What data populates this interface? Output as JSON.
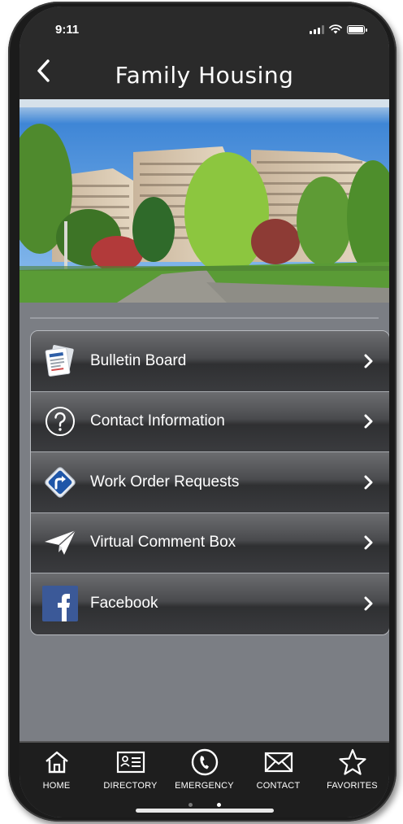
{
  "status_bar": {
    "time": "9:11"
  },
  "nav": {
    "title": "Family Housing",
    "back_icon": "chevron-left-icon"
  },
  "menu": {
    "items": [
      {
        "label": "Bulletin Board",
        "icon": "bulletin-board-icon"
      },
      {
        "label": "Contact Information",
        "icon": "question-circle-icon"
      },
      {
        "label": "Work Order Requests",
        "icon": "directions-sign-icon"
      },
      {
        "label": "Virtual Comment Box",
        "icon": "paper-plane-icon"
      },
      {
        "label": "Facebook",
        "icon": "facebook-icon"
      }
    ]
  },
  "tab_bar": {
    "tabs": [
      {
        "label": "HOME",
        "icon": "home-icon"
      },
      {
        "label": "DIRECTORY",
        "icon": "directory-card-icon"
      },
      {
        "label": "EMERGENCY",
        "icon": "phone-circle-icon"
      },
      {
        "label": "CONTACT",
        "icon": "envelope-icon"
      },
      {
        "label": "FAVORITES",
        "icon": "star-icon"
      }
    ],
    "page_count": 2,
    "active_page": 2
  },
  "colors": {
    "bar_background": "#2a2a2a",
    "screen_background": "#7b7e84",
    "facebook_blue": "#3b5998"
  }
}
